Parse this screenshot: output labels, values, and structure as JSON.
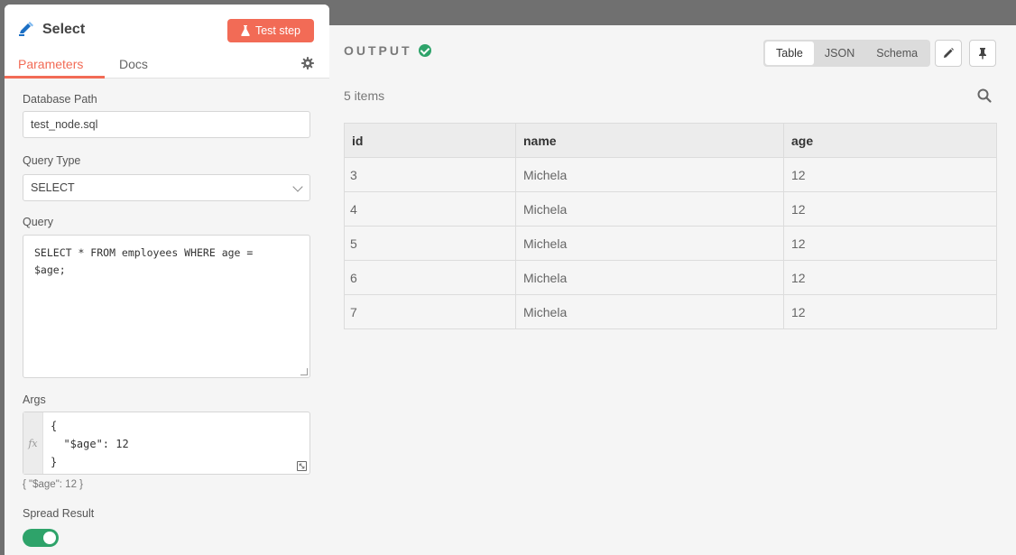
{
  "node": {
    "title": "Select",
    "test_button": "Test step",
    "tabs": [
      "Parameters",
      "Docs"
    ]
  },
  "params": {
    "db_path_label": "Database Path",
    "db_path_value": "test_node.sql",
    "query_type_label": "Query Type",
    "query_type_value": "SELECT",
    "query_label": "Query",
    "query_value": "SELECT * FROM employees WHERE age =\n$age;",
    "args_label": "Args",
    "args_code": "{\n  \"$age\": 12\n}",
    "args_preview": "{   \"$age\": 12 }",
    "spread_label": "Spread Result",
    "spread_on": true
  },
  "output": {
    "title": "OUTPUT",
    "views": [
      "Table",
      "JSON",
      "Schema"
    ],
    "active_view": "Table",
    "items_count": "5 items",
    "columns": [
      "id",
      "name",
      "age"
    ],
    "rows": [
      [
        "3",
        "Michela",
        "12"
      ],
      [
        "4",
        "Michela",
        "12"
      ],
      [
        "5",
        "Michela",
        "12"
      ],
      [
        "6",
        "Michela",
        "12"
      ],
      [
        "7",
        "Michela",
        "12"
      ]
    ]
  },
  "colors": {
    "accent": "#f26b56",
    "success": "#2ea36a"
  }
}
